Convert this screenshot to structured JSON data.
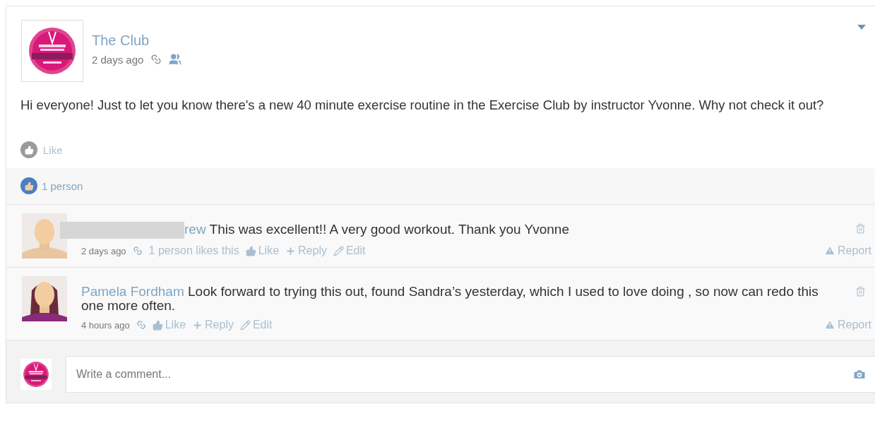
{
  "post": {
    "author": "The Club",
    "time": "2 days ago",
    "text": "Hi everyone! Just to let you know there's a new 40 minute exercise routine in the Exercise Club by instructor Yvonne. Why not check it out?",
    "like_label": "Like",
    "liked": false
  },
  "likes_summary": {
    "count": "1 person"
  },
  "comments": [
    {
      "avatar": {
        "kind": "plain"
      },
      "redacted": true,
      "author": "rew",
      "text": "This was excellent!! A very good workout. Thank you Yvonne",
      "time": "2 days ago",
      "likes": "1 person likes this",
      "actions": [
        "Like",
        "Reply",
        "Edit"
      ],
      "report": "Report"
    },
    {
      "avatar": {
        "kind": "long-hair"
      },
      "redacted": false,
      "author": "Pamela Fordham",
      "text": "Look forward to trying this out, found Sandra’s yesterday, which I used to love doing , so now can redo this one more often.",
      "time": "4 hours ago",
      "actions": [
        "Like",
        "Reply",
        "Edit"
      ],
      "report": "Report"
    }
  ],
  "composer": {
    "placeholder": "Write a comment..."
  }
}
